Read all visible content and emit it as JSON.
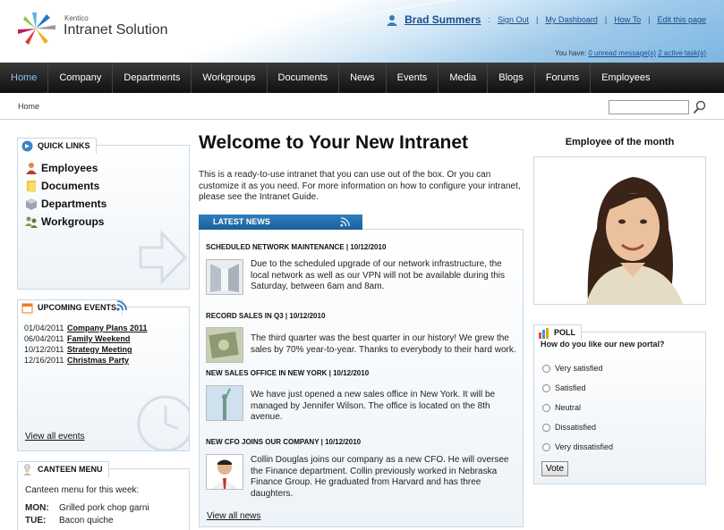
{
  "brand": {
    "small": "Kentico",
    "name": "Intranet Solution"
  },
  "userbar": {
    "user": "Brad Summers",
    "links": [
      "Sign Out",
      "My Dashboard",
      "How To",
      "Edit this page"
    ],
    "messages_prefix": "You have:",
    "unread": "0 unread message(s)",
    "tasks": "2 active task(s)"
  },
  "nav": [
    "Home",
    "Company",
    "Departments",
    "Workgroups",
    "Documents",
    "News",
    "Events",
    "Media",
    "Blogs",
    "Forums",
    "Employees"
  ],
  "breadcrumb": "Home",
  "search": {
    "placeholder": ""
  },
  "quick_links": {
    "title": "QUICK LINKS",
    "items": [
      "Employees",
      "Documents",
      "Departments",
      "Workgroups"
    ]
  },
  "events": {
    "title": "UPCOMING EVENTS",
    "items": [
      {
        "date": "01/04/2011",
        "name": "Company Plans 2011"
      },
      {
        "date": "06/04/2011",
        "name": "Family Weekend"
      },
      {
        "date": "10/12/2011",
        "name": "Strategy Meeting"
      },
      {
        "date": "12/16/2011",
        "name": "Christmas Party"
      }
    ],
    "view_all": "View all events"
  },
  "canteen": {
    "title": "CANTEEN MENU",
    "subtitle": "Canteen menu for this week:",
    "rows": [
      {
        "day": "MON:",
        "meal": "Grilled pork chop garni"
      },
      {
        "day": "TUE:",
        "meal": "Bacon quiche"
      }
    ]
  },
  "welcome": {
    "title": "Welcome to Your New Intranet",
    "intro": "This is a ready-to-use intranet that you can use out of the box. Or you can customize it as you need. For more information on how to configure your intranet, please see the Intranet Guide."
  },
  "news": {
    "title": "LATEST NEWS",
    "items": [
      {
        "headline": "SCHEDULED NETWORK MAINTENANCE | 10/12/2010",
        "text": "Due to the scheduled upgrade of our network infrastructure, the local network as well as our VPN will not be available during this Saturday, between 6am and 8am."
      },
      {
        "headline": "RECORD SALES IN Q3 | 10/12/2010",
        "text": "The third quarter was the best quarter in our history! We grew the sales by 70% year-to-year. Thanks to everybody to their hard work."
      },
      {
        "headline": "NEW SALES OFFICE IN NEW YORK | 10/12/2010",
        "text": "We have just opened a new sales office in New York. It will be managed by Jennifer Wilson. The office is located on the 8th avenue."
      },
      {
        "headline": "NEW CFO JOINS OUR COMPANY | 10/12/2010",
        "text": "Collin Douglas joins our company as a new CFO. He will oversee the Finance department. Collin previously worked in Nebraska Finance Group. He graduated from Harvard and has three daughters."
      }
    ],
    "view_all": "View all news"
  },
  "employee_of_month": {
    "title": "Employee of the month"
  },
  "poll": {
    "title": "POLL",
    "question": "How do you like our new portal?",
    "options": [
      "Very satisfied",
      "Satisfied",
      "Neutral",
      "Dissatisfied",
      "Very dissatisfied"
    ],
    "vote": "Vote"
  }
}
